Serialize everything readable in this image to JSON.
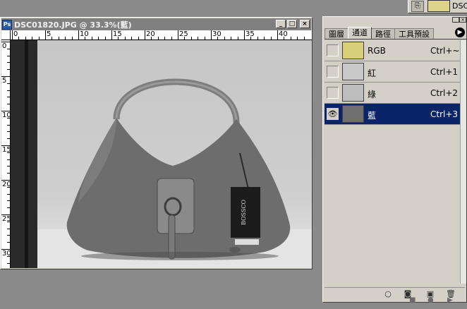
{
  "document": {
    "title": "DSC01820.JPG @ 33.3%(藍)",
    "buttons": {
      "minimize": "_",
      "maximize": "□",
      "close": "×"
    },
    "ruler_top_labels": [
      "0",
      "5",
      "10",
      "15",
      "20",
      "25",
      "30",
      "35",
      "40"
    ],
    "ruler_left_labels": [
      "0",
      "5",
      "10",
      "15",
      "20",
      "25",
      "30"
    ],
    "canvas_text": "BOSSCO"
  },
  "palette_top": {
    "label": "DSC"
  },
  "channels_palette": {
    "tabs": [
      "圖層",
      "通道",
      "路徑",
      "工具預設"
    ],
    "active_tab": 1,
    "more_button": "▶",
    "channels": [
      {
        "name": "RGB",
        "shortcut": "Ctrl+~",
        "visible": false,
        "thumb_color": "#d8cf7a",
        "selected": false
      },
      {
        "name": "紅",
        "shortcut": "Ctrl+1",
        "visible": false,
        "thumb_color": "#c9c9c9",
        "selected": false
      },
      {
        "name": "綠",
        "shortcut": "Ctrl+2",
        "visible": false,
        "thumb_color": "#bdbdbd",
        "selected": false
      },
      {
        "name": "藍",
        "shortcut": "Ctrl+3",
        "visible": true,
        "thumb_color": "#6f6f6f",
        "selected": true
      }
    ],
    "footer_icons": [
      "load-selection-icon",
      "save-selection-icon",
      "new-channel-icon",
      "trash-icon"
    ]
  },
  "colors": {
    "selection": "#0a246a",
    "panel": "#d4d0c8",
    "workspace": "#8a8a8a"
  }
}
